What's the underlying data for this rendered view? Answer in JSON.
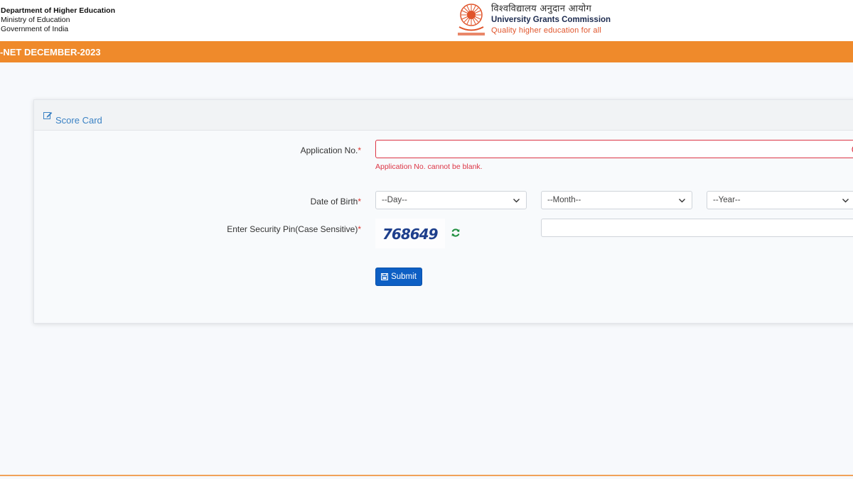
{
  "header": {
    "dept_title": "Department of Higher Education",
    "ministry": "Ministry of Education",
    "government": "Government of India",
    "ugc_hindi": "विश्वविद्यालय अनुदान आयोग",
    "ugc_english": "University Grants Commission",
    "ugc_tagline": "Quality higher education for all",
    "logo_icon": "ugc-emblem-icon"
  },
  "banner": {
    "exam_title": "-NET DECEMBER-2023",
    "color": "#ef8a2b"
  },
  "card": {
    "title": "Score Card",
    "title_icon": "edit-icon"
  },
  "form": {
    "application_label": "Application No.",
    "application_value": "",
    "application_error": "Application No. cannot be blank.",
    "dob_label": "Date of Birth",
    "day_selected": "--Day--",
    "month_selected": "--Month--",
    "year_selected": "--Year--",
    "pin_label": "Enter Security Pin(Case Sensitive)",
    "captcha_text": "768649",
    "pin_value": "",
    "required_mark": "*",
    "submit_label": "Submit"
  },
  "colors": {
    "accent": "#0d5fc4",
    "error": "#dc3545",
    "link": "#3b82c4"
  }
}
